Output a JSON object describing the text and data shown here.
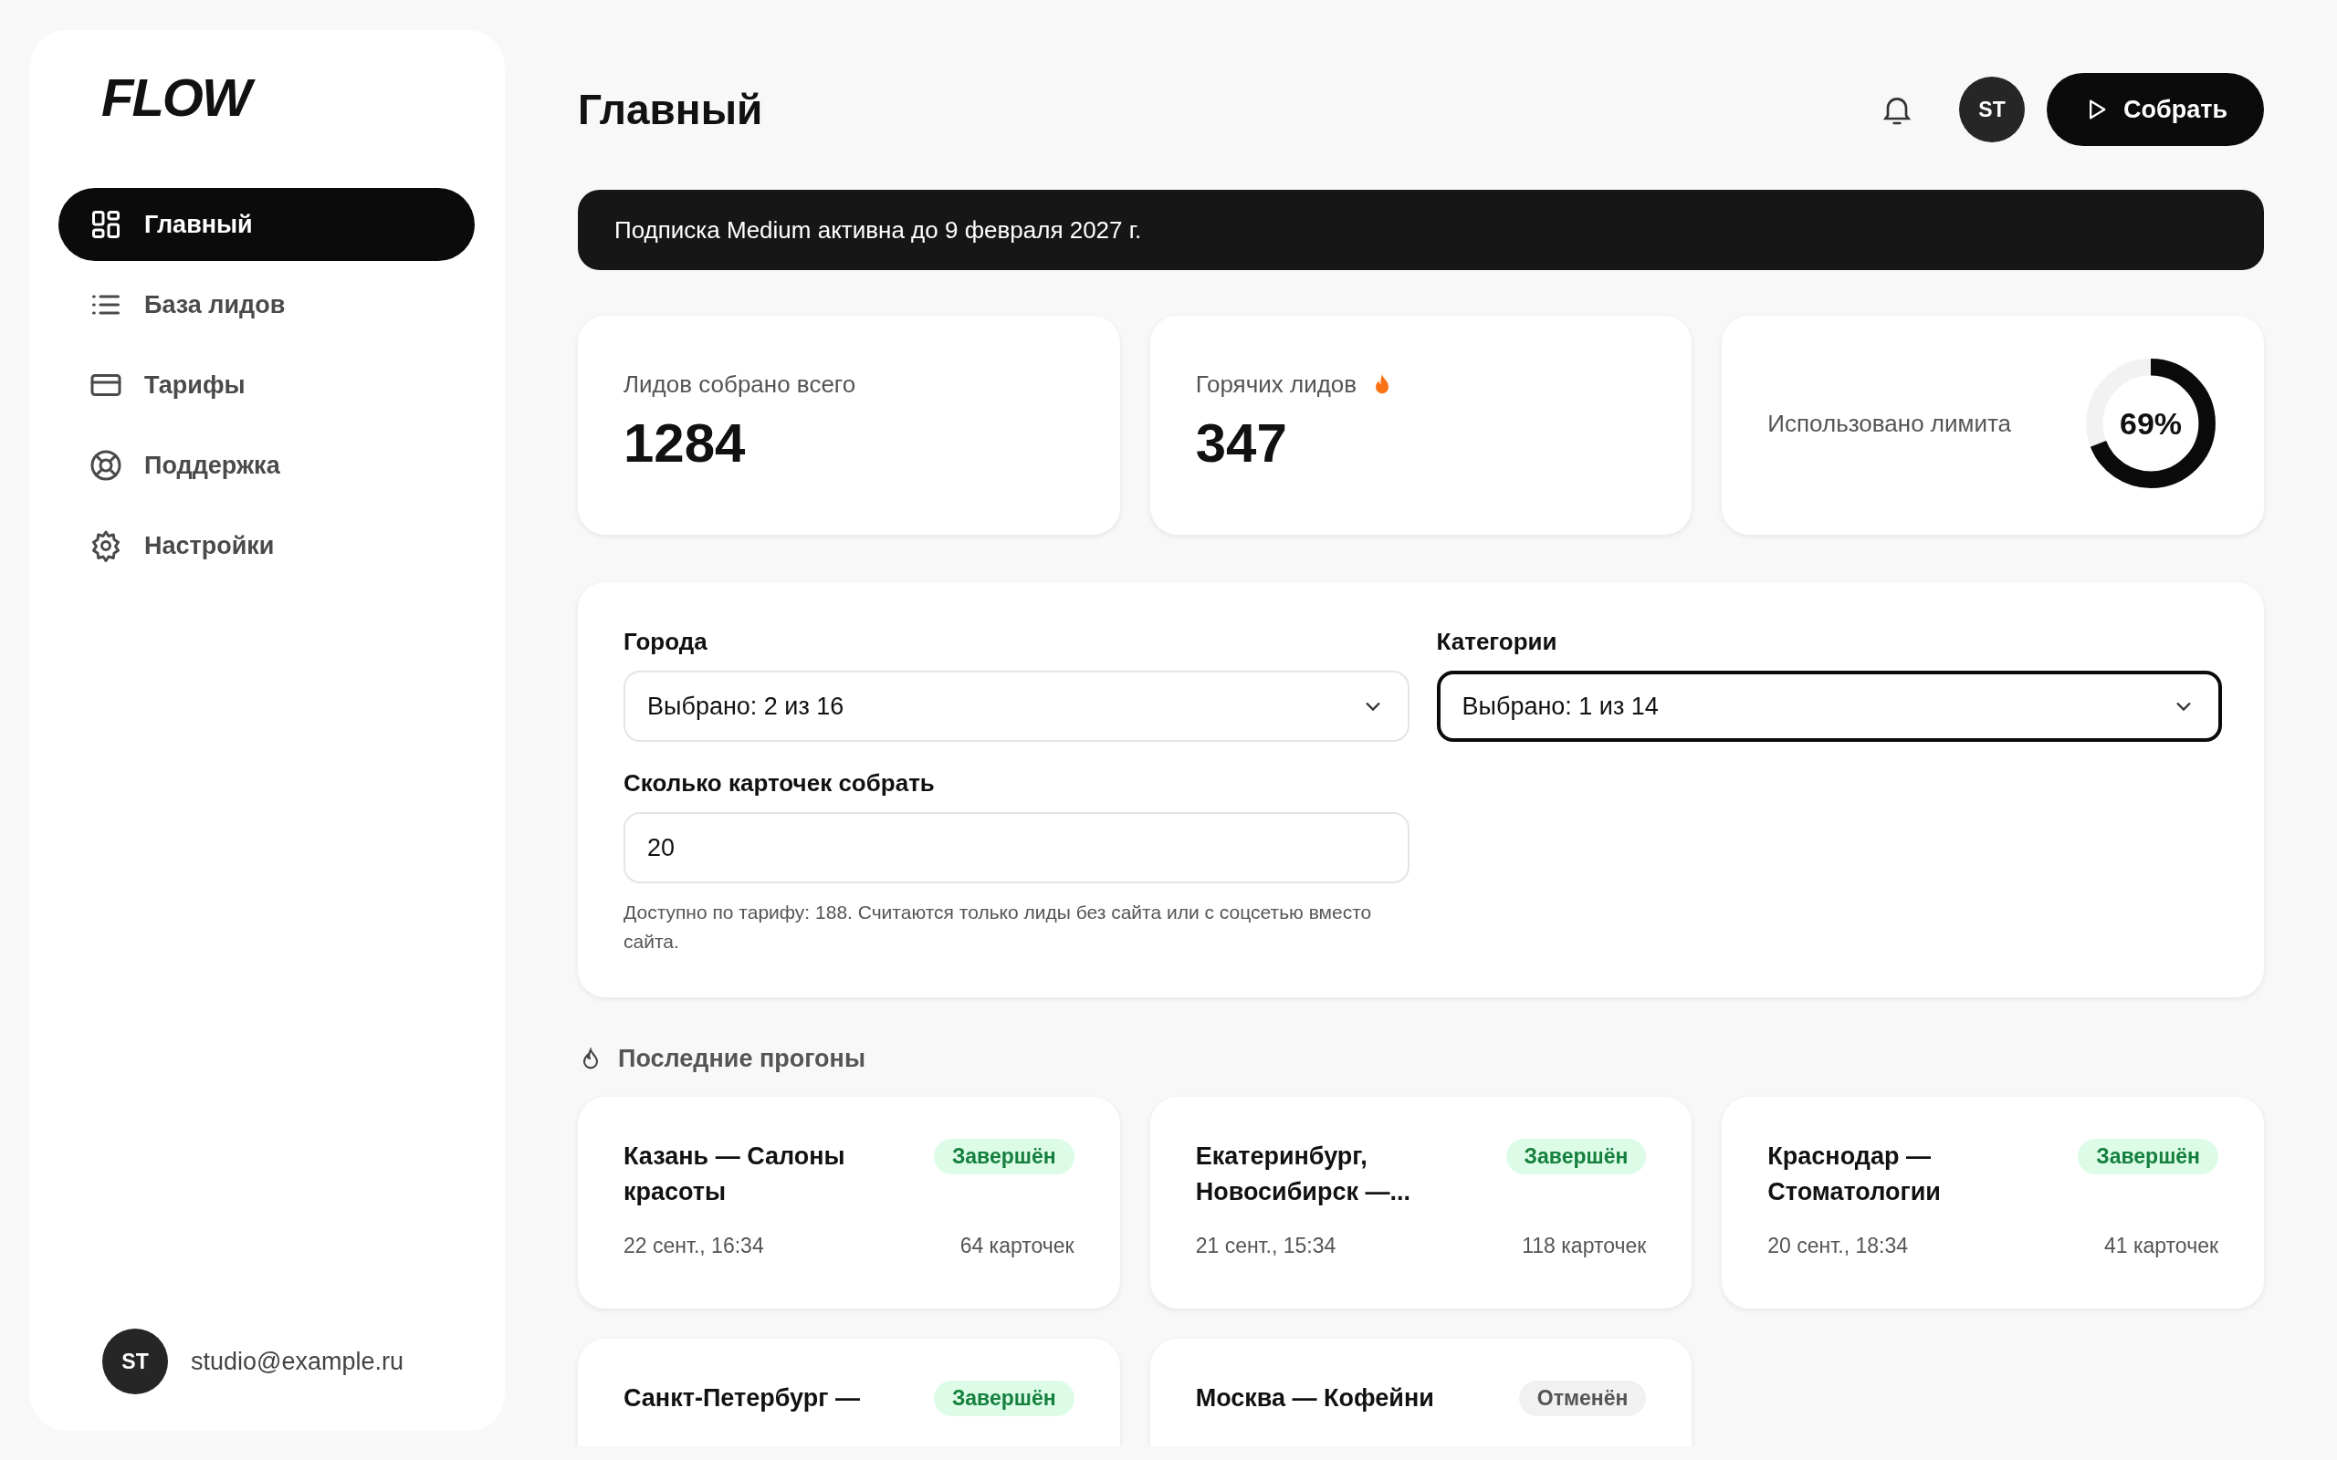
{
  "sidebar": {
    "logo": "FLOW",
    "items": [
      {
        "label": "Главный",
        "kind": "dashboard",
        "selected": true
      },
      {
        "label": "База лидов",
        "kind": "leads",
        "selected": false
      },
      {
        "label": "Тарифы",
        "kind": "plans",
        "selected": false
      },
      {
        "label": "Поддержка",
        "kind": "support",
        "selected": false
      },
      {
        "label": "Настройки",
        "kind": "settings",
        "selected": false
      }
    ],
    "user": {
      "initials": "ST",
      "email": "studio@example.ru"
    }
  },
  "header": {
    "title": "Главный",
    "avatar": "ST",
    "button": "Собрать"
  },
  "banner": "Подписка Medium активна до 9 февраля 2027 г.",
  "stats": [
    {
      "kind": "number",
      "label": "Лидов собрано всего",
      "value": "1284"
    },
    {
      "kind": "hot",
      "label": "Горячих лидов",
      "value": "347"
    },
    {
      "kind": "ring",
      "label": "Использовано лимита",
      "value": "69%",
      "level": 0.69
    }
  ],
  "filters": {
    "cities": {
      "label": "Города",
      "value": "Выбрано: 2 из 16",
      "focused": false
    },
    "categories": {
      "label": "Категории",
      "value": "Выбрано: 1 из 14",
      "focused": true
    },
    "count": {
      "label": "Сколько карточек собрать",
      "value": "20",
      "hint": "Доступно по тарифу: 188. Считаются только лиды без сайта или с соцсетью вместо сайта."
    }
  },
  "runs": {
    "title": "Последние прогоны",
    "items": [
      {
        "title": "Казань — Салоны красоты",
        "status": "Завершён",
        "kind": "done",
        "date": "22 сент., 16:34",
        "cards": "64 карточек"
      },
      {
        "title": "Екатеринбург, Новосибирск —...",
        "status": "Завершён",
        "kind": "done",
        "date": "21 сент., 15:34",
        "cards": "118 карточек"
      },
      {
        "title": "Краснодар — Стоматологии",
        "status": "Завершён",
        "kind": "done",
        "date": "20 сент., 18:34",
        "cards": "41 карточек"
      },
      {
        "title": "Санкт-Петербург —",
        "status": "Завершён",
        "kind": "done"
      },
      {
        "title": "Москва — Кофейни",
        "status": "Отменён",
        "kind": "cancelled"
      }
    ]
  }
}
